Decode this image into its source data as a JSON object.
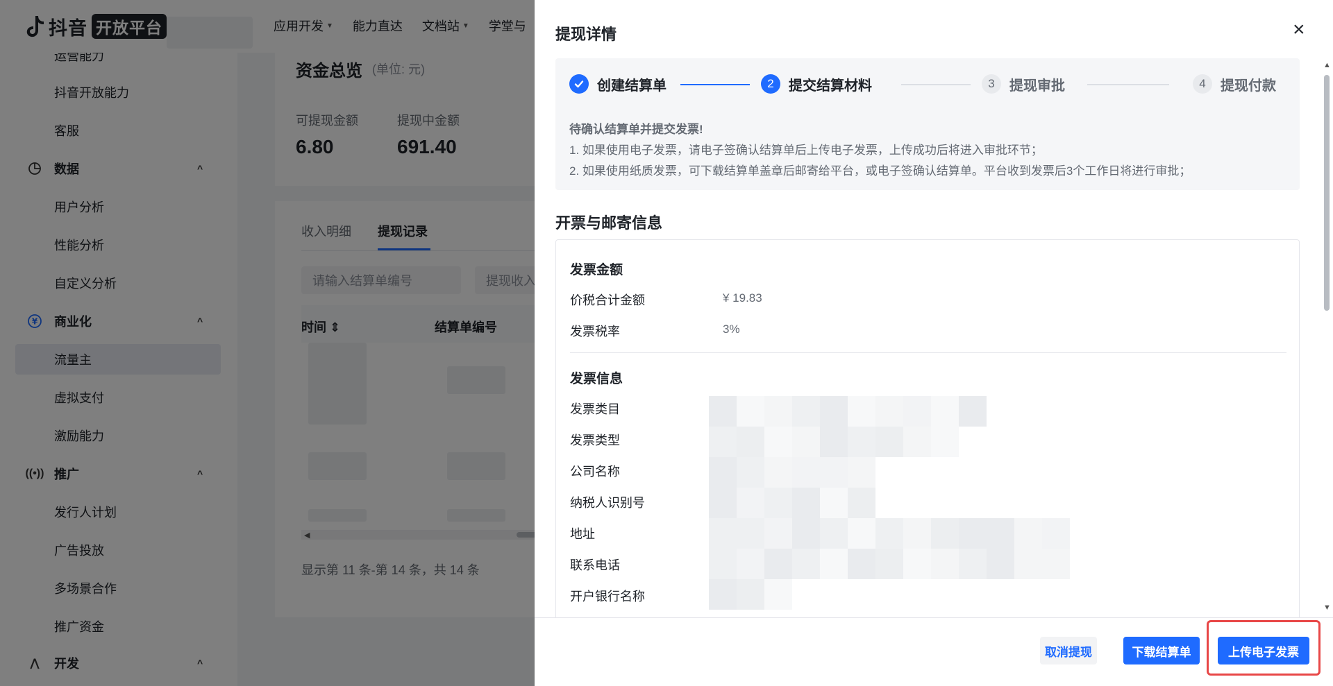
{
  "app": {
    "logo_text": "抖音",
    "logo_badge": "开放平台"
  },
  "topnav": [
    {
      "label": "应用开发",
      "caret": true
    },
    {
      "label": "能力直达",
      "caret": false
    },
    {
      "label": "文档站",
      "caret": true
    },
    {
      "label": "学堂与",
      "caret": false
    }
  ],
  "sidebar": {
    "items": [
      {
        "label": "运营能力",
        "type": "sub"
      },
      {
        "label": "抖音开放能力",
        "type": "sub"
      },
      {
        "label": "客服",
        "type": "sub"
      },
      {
        "label": "数据",
        "type": "group",
        "icon": "pie-chart-icon"
      },
      {
        "label": "用户分析",
        "type": "sub"
      },
      {
        "label": "性能分析",
        "type": "sub"
      },
      {
        "label": "自定义分析",
        "type": "sub"
      },
      {
        "label": "商业化",
        "type": "group",
        "icon": "yuan-circle-icon"
      },
      {
        "label": "流量主",
        "type": "active"
      },
      {
        "label": "虚拟支付",
        "type": "sub"
      },
      {
        "label": "激励能力",
        "type": "sub"
      },
      {
        "label": "推广",
        "type": "group",
        "icon": "broadcast-icon"
      },
      {
        "label": "发行人计划",
        "type": "sub"
      },
      {
        "label": "广告投放",
        "type": "sub"
      },
      {
        "label": "多场景合作",
        "type": "sub"
      },
      {
        "label": "推广资金",
        "type": "sub"
      },
      {
        "label": "开发",
        "type": "group",
        "icon": "dev-icon"
      }
    ]
  },
  "main": {
    "fund_title": "资金总览",
    "fund_unit": "(单位: 元)",
    "stats": [
      {
        "label": "可提现金额",
        "value": "6.80"
      },
      {
        "label": "提现中金额",
        "value": "691.40"
      }
    ],
    "tabs": [
      "收入明细",
      "提现记录"
    ],
    "filters": {
      "order_placeholder": "请输入结算单编号",
      "type_placeholder": "提现收入"
    },
    "columns": [
      "时间",
      "结算单编号"
    ],
    "pagination": "显示第 11 条-第 14 条，共 14 条"
  },
  "drawer": {
    "title": "提现详情",
    "close_icon": "×",
    "steps": [
      {
        "num": "",
        "label": "创建结算单",
        "status": "done"
      },
      {
        "num": "2",
        "label": "提交结算材料",
        "status": "current"
      },
      {
        "num": "3",
        "label": "提现审批",
        "status": "todo"
      },
      {
        "num": "4",
        "label": "提现付款",
        "status": "todo"
      }
    ],
    "notice": {
      "title": "待确认结算单并提交发票!",
      "lines": [
        "1. 如果使用电子发票，请电子签确认结算单后上传电子发票，上传成功后将进入审批环节；",
        "2. 如果使用纸质发票，可下载结算单盖章后邮寄给平台，或电子签确认结算单。平台收到发票后3个工作日将进行审批；"
      ]
    },
    "section_title": "开票与邮寄信息",
    "amount_section": {
      "title": "发票金额",
      "rows": [
        {
          "label": "价税合计金额",
          "value": "¥ 19.83"
        },
        {
          "label": "发票税率",
          "value": "3%"
        }
      ]
    },
    "invoice_section": {
      "title": "发票信息",
      "labels": [
        "发票类目",
        "发票类型",
        "公司名称",
        "纳税人识别号",
        "地址",
        "联系电话",
        "开户银行名称"
      ]
    },
    "buttons": {
      "cancel": "取消提现",
      "download": "下载结算单",
      "upload": "上传电子发票"
    }
  },
  "colors": {
    "primary": "#1f6bff",
    "highlight": "#e84747"
  }
}
